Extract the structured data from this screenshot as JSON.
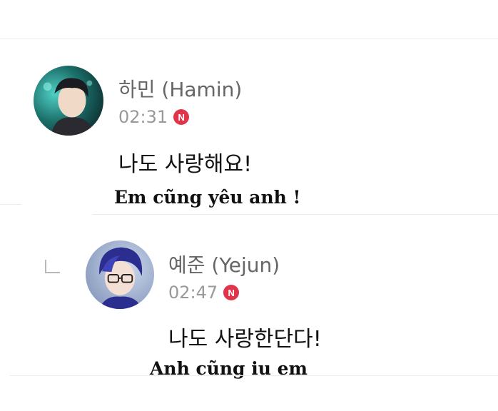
{
  "comments": [
    {
      "author": "하민 (Hamin)",
      "time": "02:31",
      "badge": "N",
      "message": "나도 사랑해요!",
      "caption": "Em cũng yêu anh !",
      "avatar_icon": "avatar-dark-hair",
      "is_reply": false
    },
    {
      "author": "예준 (Yejun)",
      "time": "02:47",
      "badge": "N",
      "message": "나도 사랑한단다!",
      "caption": "Anh cũng iu em",
      "avatar_icon": "avatar-glasses",
      "is_reply": true
    }
  ],
  "colors": {
    "badge": "#e0344b",
    "divider": "#ececec",
    "meta_text": "#999999"
  }
}
